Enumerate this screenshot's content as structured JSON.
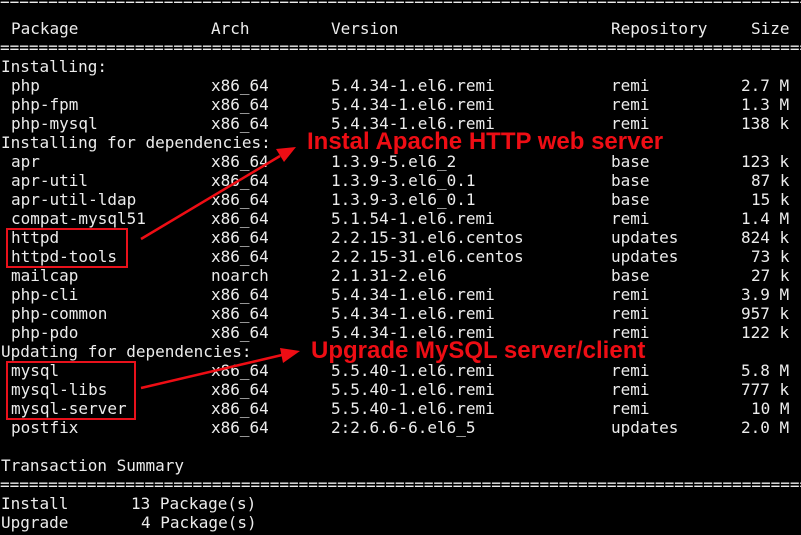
{
  "separator": "================================================================================================",
  "headers": {
    "package": "Package",
    "arch": "Arch",
    "version": "Version",
    "repository": "Repository",
    "size": "Size"
  },
  "sections": {
    "installing": "Installing:",
    "installing_deps": "Installing for dependencies:",
    "updating_deps": "Updating for dependencies:"
  },
  "rows": [
    {
      "package": "php",
      "arch": "x86_64",
      "version": "5.4.34-1.el6.remi",
      "repo": "remi",
      "size": "2.7 M"
    },
    {
      "package": "php-fpm",
      "arch": "x86_64",
      "version": "5.4.34-1.el6.remi",
      "repo": "remi",
      "size": "1.3 M"
    },
    {
      "package": "php-mysql",
      "arch": "x86_64",
      "version": "5.4.34-1.el6.remi",
      "repo": "remi",
      "size": "138 k"
    },
    {
      "package": "apr",
      "arch": "x86_64",
      "version": "1.3.9-5.el6_2",
      "repo": "base",
      "size": "123 k"
    },
    {
      "package": "apr-util",
      "arch": "x86_64",
      "version": "1.3.9-3.el6_0.1",
      "repo": "base",
      "size": "87 k"
    },
    {
      "package": "apr-util-ldap",
      "arch": "x86_64",
      "version": "1.3.9-3.el6_0.1",
      "repo": "base",
      "size": "15 k"
    },
    {
      "package": "compat-mysql51",
      "arch": "x86_64",
      "version": "5.1.54-1.el6.remi",
      "repo": "remi",
      "size": "1.4 M"
    },
    {
      "package": "httpd",
      "arch": "x86_64",
      "version": "2.2.15-31.el6.centos",
      "repo": "updates",
      "size": "824 k"
    },
    {
      "package": "httpd-tools",
      "arch": "x86_64",
      "version": "2.2.15-31.el6.centos",
      "repo": "updates",
      "size": "73 k"
    },
    {
      "package": "mailcap",
      "arch": "noarch",
      "version": "2.1.31-2.el6",
      "repo": "base",
      "size": "27 k"
    },
    {
      "package": "php-cli",
      "arch": "x86_64",
      "version": "5.4.34-1.el6.remi",
      "repo": "remi",
      "size": "3.9 M"
    },
    {
      "package": "php-common",
      "arch": "x86_64",
      "version": "5.4.34-1.el6.remi",
      "repo": "remi",
      "size": "957 k"
    },
    {
      "package": "php-pdo",
      "arch": "x86_64",
      "version": "5.4.34-1.el6.remi",
      "repo": "remi",
      "size": "122 k"
    },
    {
      "package": "mysql",
      "arch": "x86_64",
      "version": "5.5.40-1.el6.remi",
      "repo": "remi",
      "size": "5.8 M"
    },
    {
      "package": "mysql-libs",
      "arch": "x86_64",
      "version": "5.5.40-1.el6.remi",
      "repo": "remi",
      "size": "777 k"
    },
    {
      "package": "mysql-server",
      "arch": "x86_64",
      "version": "5.5.40-1.el6.remi",
      "repo": "remi",
      "size": "10 M"
    },
    {
      "package": "postfix",
      "arch": "x86_64",
      "version": "2:2.6.6-6.el6_5",
      "repo": "updates",
      "size": "2.0 M"
    }
  ],
  "summary": {
    "title": "Transaction Summary",
    "install_label": "Install",
    "install_count": "13 Package(s)",
    "upgrade_label": "Upgrade",
    "upgrade_count": "4 Package(s)"
  },
  "annotations": {
    "apache": "Instal Apache HTTP web server",
    "mysql": "Upgrade MySQL server/client",
    "color": "#ee0d14"
  }
}
